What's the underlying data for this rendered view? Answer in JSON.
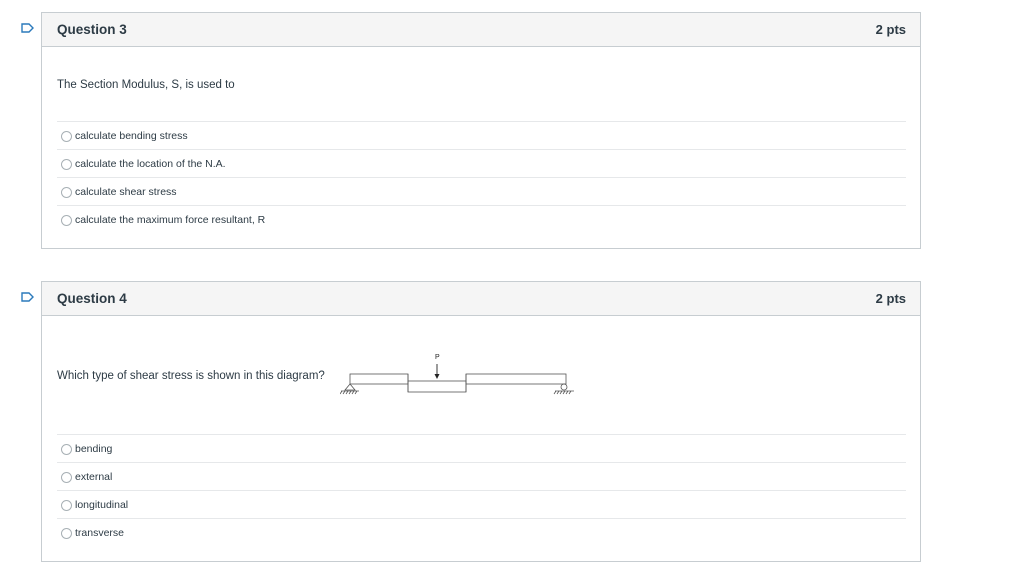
{
  "questions": [
    {
      "title": "Question 3",
      "points": "2 pts",
      "text": "The Section Modulus, S, is used to",
      "answers": [
        "calculate bending stress",
        "calculate the location of the N.A.",
        "calculate shear stress",
        "calculate the maximum force resultant, R"
      ]
    },
    {
      "title": "Question 4",
      "points": "2 pts",
      "text": "Which type of shear stress is shown in this diagram?",
      "diagram": {
        "load_label": "P"
      },
      "answers": [
        "bending",
        "external",
        "longitudinal",
        "transverse"
      ]
    }
  ],
  "colors": {
    "flag": "#2b7abc",
    "border": "#c7cdd1",
    "header_bg": "#f5f5f5",
    "text": "#2d3b45"
  },
  "icons": {
    "flag": "bookmark-flag-icon",
    "radio": "radio-button"
  }
}
